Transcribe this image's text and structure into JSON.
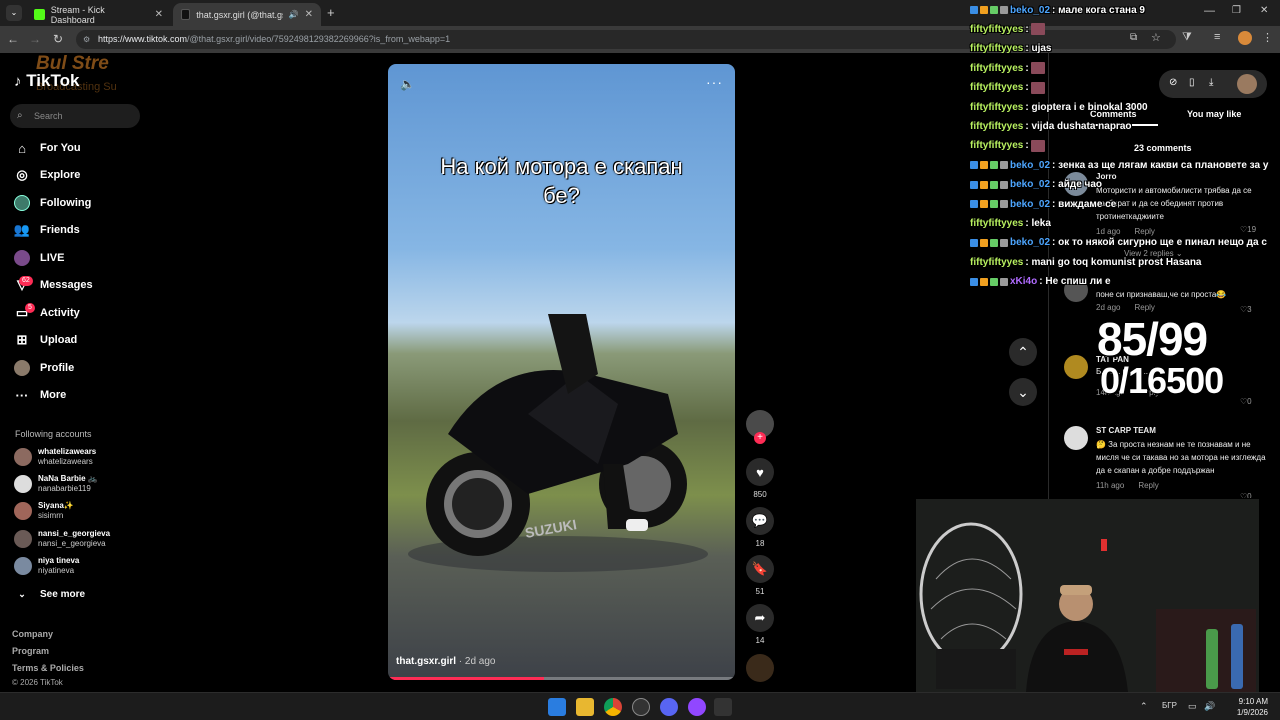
{
  "browser": {
    "tabs": [
      {
        "title": "Stream - Kick Dashboard",
        "active": false
      },
      {
        "title": "that.gsxr.girl (@that.gsxr.gi",
        "active": true
      }
    ],
    "url_host": "https://www.tiktok.com",
    "url_path": "/@that.gsxr.girl/video/7592498129382269966?is_from_webapp=1"
  },
  "overlay_brand": {
    "line1": "Bul Stre",
    "line2": "Broadcasting Su"
  },
  "sidebar": {
    "logo": "TikTok",
    "search_placeholder": "Search",
    "nav": [
      {
        "label": "For You",
        "icon": "home-icon"
      },
      {
        "label": "Explore",
        "icon": "compass-icon"
      },
      {
        "label": "Following",
        "icon": "following-icon"
      },
      {
        "label": "Friends",
        "icon": "friends-icon"
      },
      {
        "label": "LIVE",
        "icon": "live-icon"
      },
      {
        "label": "Messages",
        "icon": "messages-icon",
        "badge": "62"
      },
      {
        "label": "Activity",
        "icon": "activity-icon",
        "badge": "5"
      },
      {
        "label": "Upload",
        "icon": "upload-icon"
      },
      {
        "label": "Profile",
        "icon": "profile-icon"
      },
      {
        "label": "More",
        "icon": "more-icon"
      }
    ],
    "following_title": "Following accounts",
    "accounts": [
      {
        "name": "whatelizawears",
        "handle": "whatelizawears"
      },
      {
        "name": "NaNa Barbie 🚲",
        "handle": "nanabarbie119"
      },
      {
        "name": "Siyana✨",
        "handle": "sisimrn"
      },
      {
        "name": "nansi_e_georgieva",
        "handle": "nansi_e_georgieva"
      },
      {
        "name": "niya tineva",
        "handle": "niyatineva"
      }
    ],
    "see_more": "See more",
    "footer": {
      "company": "Company",
      "program": "Program",
      "terms": "Terms & Policies",
      "copyright": "© 2026 TikTok"
    }
  },
  "video": {
    "caption_line1": "На кой мотора е скапан",
    "caption_line2": "бе?",
    "author": "that.gsxr.girl",
    "time_ago": "· 2d ago",
    "progress": 0.45
  },
  "actions": {
    "likes": "850",
    "comments": "18",
    "saves": "51",
    "shares": "14"
  },
  "comments_panel": {
    "tab_comments": "Comments",
    "tab_you_may_like": "You may like",
    "count": "23 comments",
    "items": [
      {
        "user": "Jorro",
        "text": "Мотористи и автомобилисти трябва да се разбират и да се обединят против тротинеткаджиите",
        "time": "1d ago",
        "reply": "Reply",
        "likes": "19",
        "sub": "View 2 replies ⌄"
      },
      {
        "user": "",
        "text": "поне си признаваш,че си проста😂",
        "time": "2d ago",
        "reply": "Reply",
        "likes": "3"
      },
      {
        "user": "TAT PAN",
        "text": "Б... к... м... н...",
        "time": "14h ago",
        "reply": "Reply",
        "likes": "0"
      },
      {
        "user": "ST CARP TEAM",
        "text": "🤔 За проста незнам не те познавам и не мисля че си такава но за мотора не изглежда да е скапан а добре поддържан",
        "time": "11h ago",
        "reply": "Reply",
        "likes": "0"
      }
    ]
  },
  "chat": [
    {
      "user": "beko_02",
      "color": "#4da6ff",
      "badges": true,
      "text": ": мале кога стана 9"
    },
    {
      "user": "fiftyfiftyyes",
      "color": "#b8f060",
      "badges": false,
      "text": ": "
    },
    {
      "user": "fiftyfiftyyes",
      "color": "#b8f060",
      "badges": false,
      "text": ": ujas"
    },
    {
      "user": "fiftyfiftyyes",
      "color": "#b8f060",
      "badges": false,
      "text": ": "
    },
    {
      "user": "fiftyfiftyyes",
      "color": "#b8f060",
      "badges": false,
      "text": ": "
    },
    {
      "user": "fiftyfiftyyes",
      "color": "#b8f060",
      "badges": false,
      "text": ": gioptera i e binokal 3000"
    },
    {
      "user": "fiftyfiftyyes",
      "color": "#b8f060",
      "badges": false,
      "text": ": vijda dushata naprao"
    },
    {
      "user": "fiftyfiftyyes",
      "color": "#b8f060",
      "badges": false,
      "text": ": "
    },
    {
      "user": "beko_02",
      "color": "#4da6ff",
      "badges": true,
      "text": ": зенка аз ще лягам какви са плановете за у"
    },
    {
      "user": "beko_02",
      "color": "#4da6ff",
      "badges": true,
      "text": ": айде чао"
    },
    {
      "user": "beko_02",
      "color": "#4da6ff",
      "badges": true,
      "text": ": виждаме се"
    },
    {
      "user": "fiftyfiftyyes",
      "color": "#b8f060",
      "badges": false,
      "text": ": leka"
    },
    {
      "user": "beko_02",
      "color": "#4da6ff",
      "badges": true,
      "text": ": ок то някой сигурно ще е пинал нещо да с"
    },
    {
      "user": "fiftyfiftyyes",
      "color": "#b8f060",
      "badges": false,
      "text": ": mani go toq komunist prost Hasana"
    },
    {
      "user": "xKi4o",
      "color": "#b06bff",
      "badges": true,
      "text": ": Не спиш ли е"
    }
  ],
  "counter": {
    "line1": "85/99",
    "line2": "0/16500"
  },
  "taskbar": {
    "lang": "БГР",
    "time": "9:10 AM",
    "date": "1/9/2026"
  },
  "colors": {
    "tiktok_red": "#fe2c55",
    "chat_green": "#b8f060",
    "chat_blue": "#4da6ff",
    "chat_purple": "#b06bff"
  }
}
